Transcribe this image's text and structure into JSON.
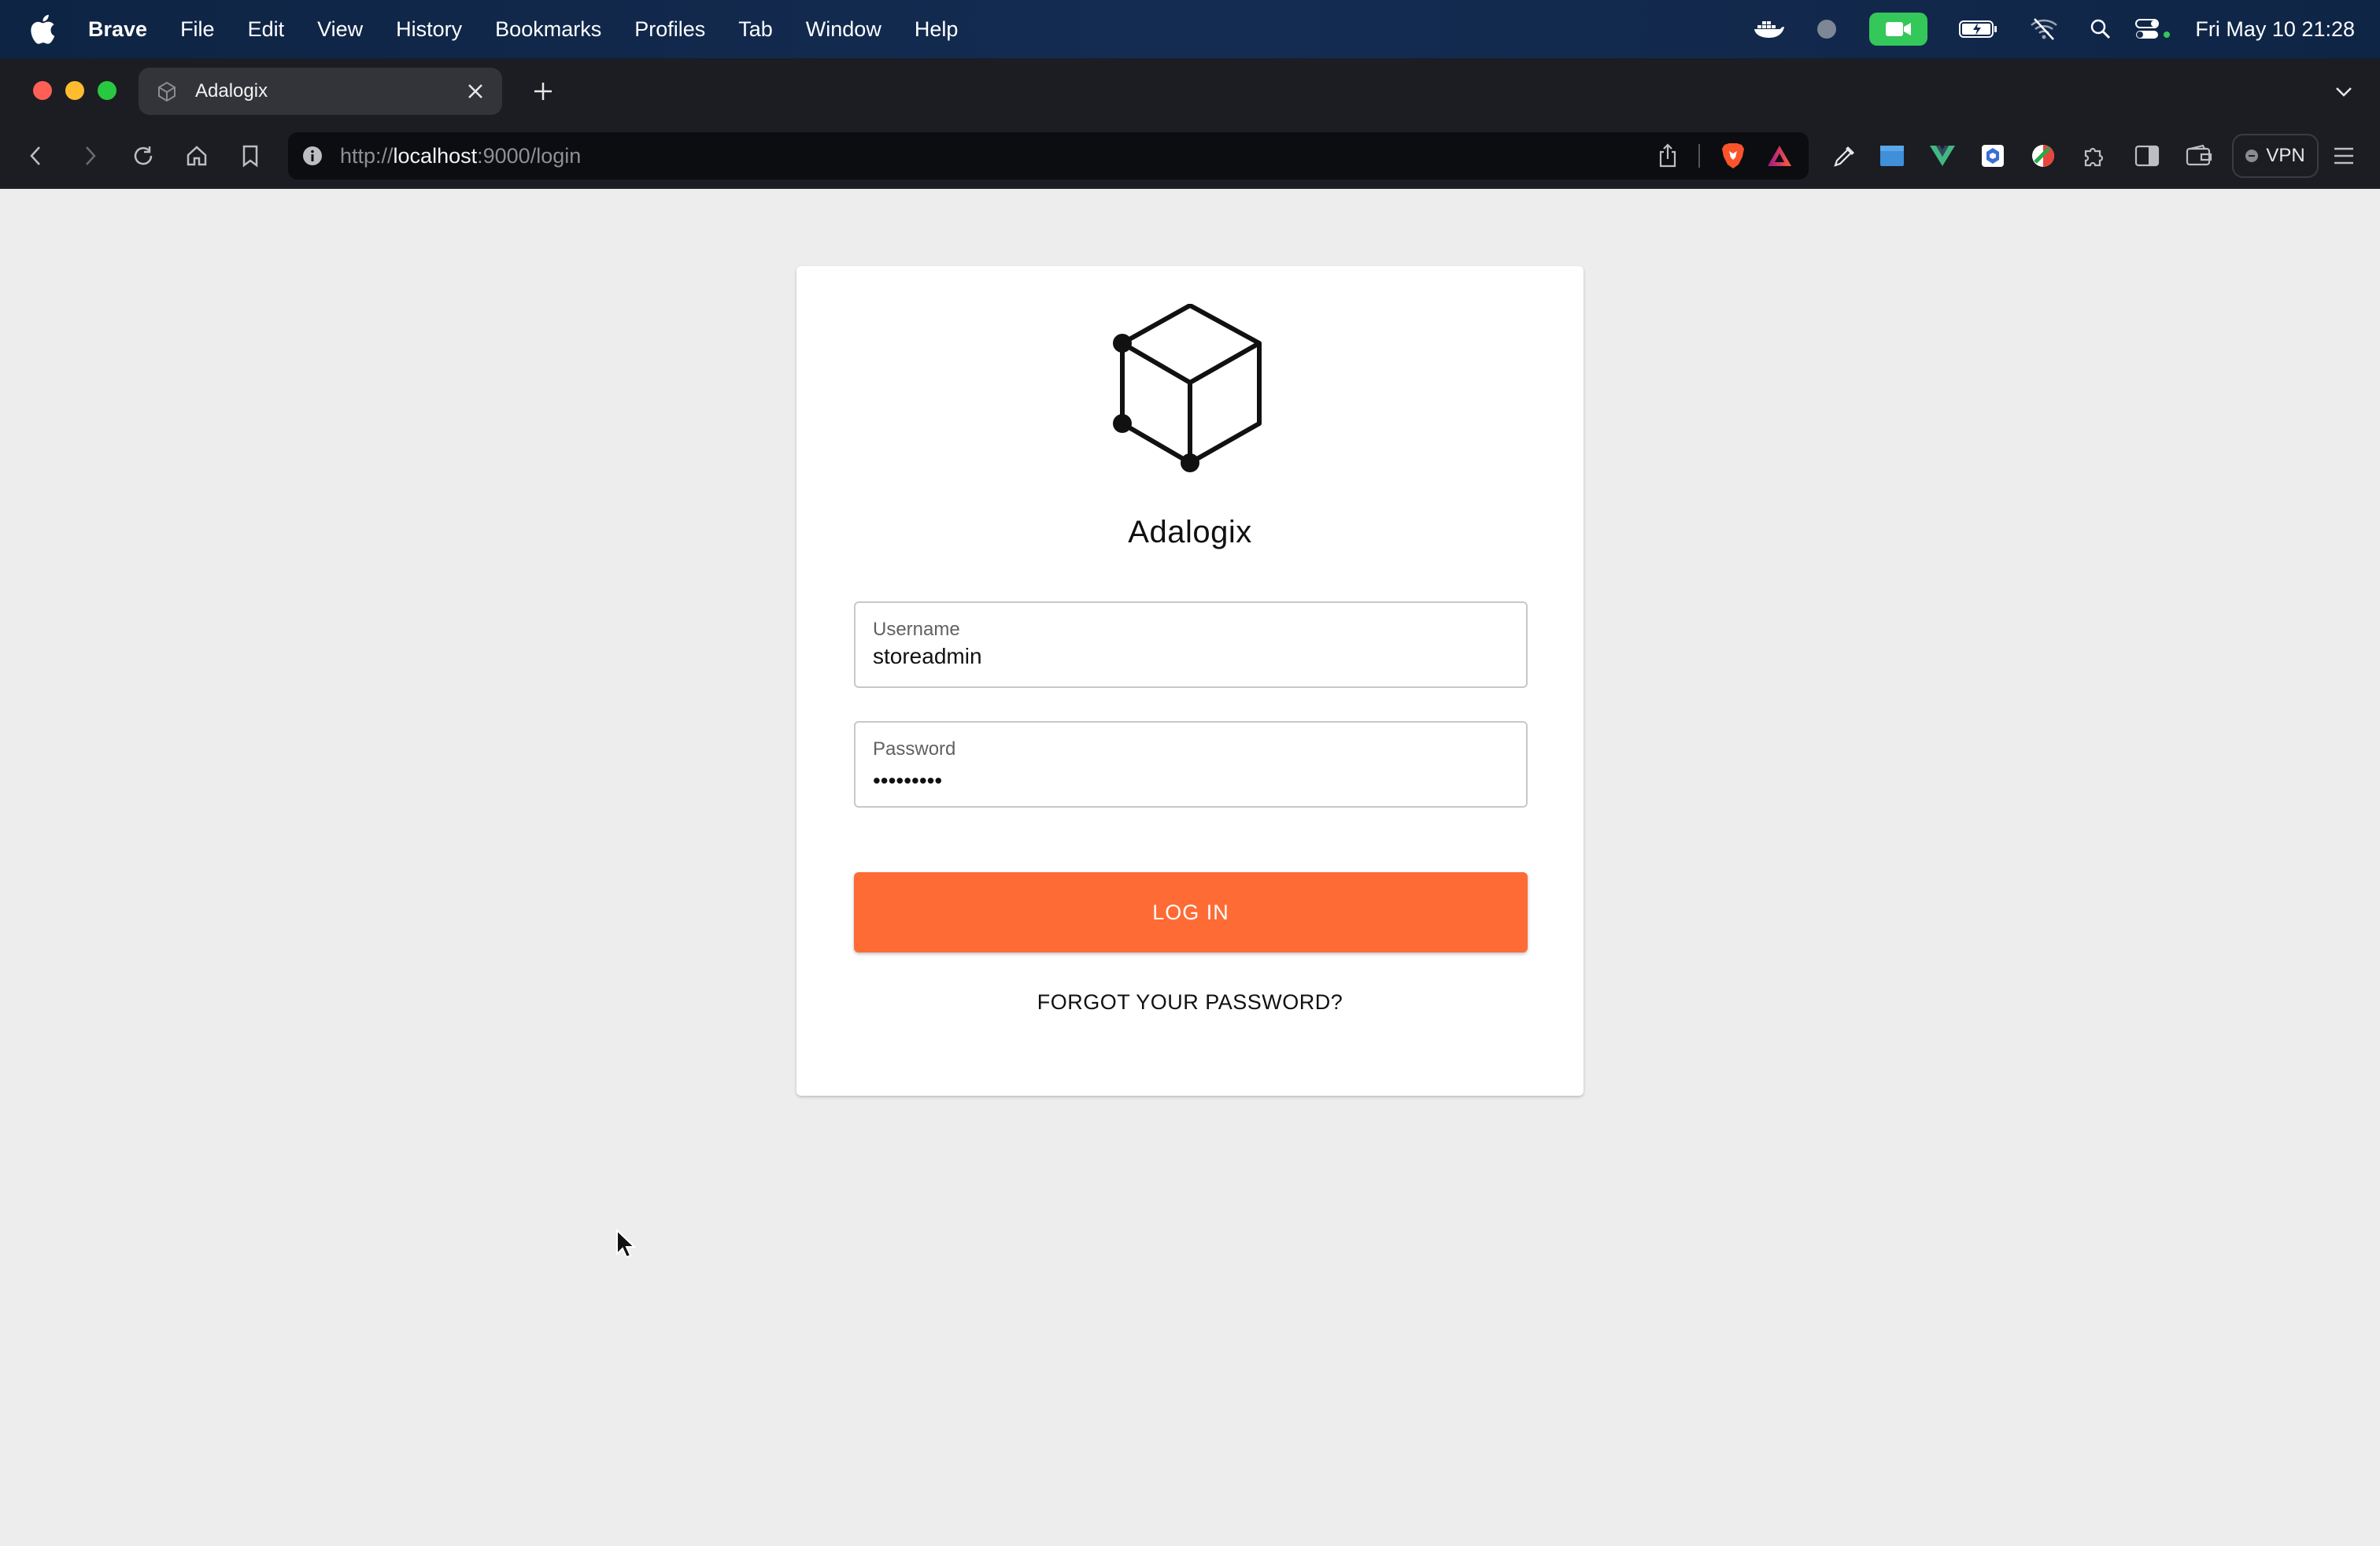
{
  "menubar": {
    "app_name": "Brave",
    "items": [
      "File",
      "Edit",
      "View",
      "History",
      "Bookmarks",
      "Profiles",
      "Tab",
      "Window",
      "Help"
    ],
    "clock": "Fri May 10  21:28",
    "status_icons": [
      "docker-icon",
      "circle-status-icon",
      "facetime-icon",
      "battery-icon",
      "wifi-off-icon",
      "spotlight-search-icon",
      "control-center-icon"
    ]
  },
  "browser": {
    "tab_title": "Adalogix",
    "url": {
      "scheme": "http://",
      "host": "localhost",
      "rest": ":9000/login"
    },
    "vpn_label": "VPN"
  },
  "login": {
    "brand_name": "Adalogix",
    "username_label": "Username",
    "username_value": "storeadmin",
    "password_label": "Password",
    "password_masked": "•••••••••",
    "login_button": "LOG IN",
    "forgot_link": "FORGOT YOUR PASSWORD?"
  },
  "colors": {
    "primary_button": "#ff6b35",
    "page_background": "#ededed",
    "card_background": "#ffffff"
  }
}
